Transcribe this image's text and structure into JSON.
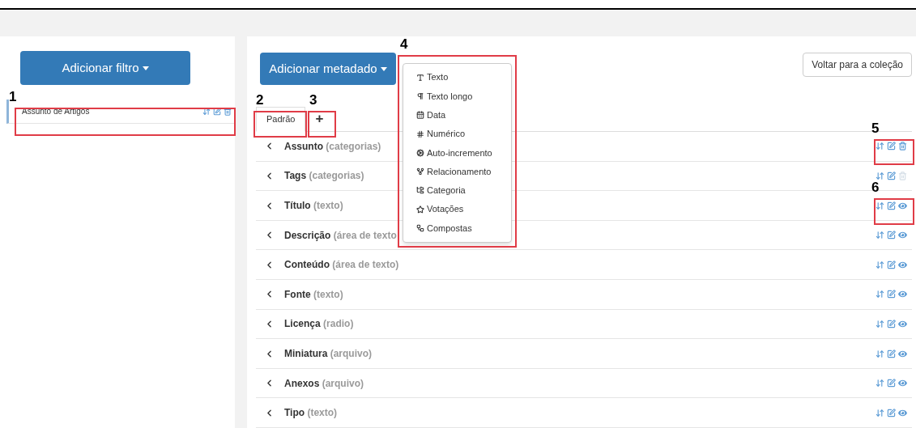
{
  "filter_panel": {
    "add_button": "Adicionar filtro",
    "filters": [
      {
        "label": "Assunto de Artigos"
      }
    ]
  },
  "metadata_panel": {
    "add_button": "Adicionar metadado",
    "back_button": "Voltar para a coleção",
    "tabs": [
      {
        "label": "Padrão",
        "selected": true
      },
      {
        "label": "+",
        "selected": false
      }
    ],
    "rows": [
      {
        "name": "Assunto",
        "type": "(categorias)",
        "kind": "delete",
        "disabled": false
      },
      {
        "name": "Tags",
        "type": "(categorias)",
        "kind": "delete",
        "disabled": true
      },
      {
        "name": "Título",
        "type": "(texto)",
        "kind": "visibility"
      },
      {
        "name": "Descrição",
        "type": "(área de texto",
        "kind": "visibility"
      },
      {
        "name": "Conteúdo",
        "type": "(área de texto)",
        "kind": "visibility"
      },
      {
        "name": "Fonte",
        "type": "(texto)",
        "kind": "visibility"
      },
      {
        "name": "Licença",
        "type": "(radio)",
        "kind": "visibility"
      },
      {
        "name": "Miniatura",
        "type": "(arquivo)",
        "kind": "visibility"
      },
      {
        "name": "Anexos",
        "type": "(arquivo)",
        "kind": "visibility"
      },
      {
        "name": "Tipo",
        "type": "(texto)",
        "kind": "visibility"
      }
    ],
    "dropdown_menu": [
      "Texto",
      "Texto longo",
      "Data",
      "Numérico",
      "Auto-incremento",
      "Relacionamento",
      "Categoria",
      "Votações",
      "Compostas"
    ]
  },
  "annotations": [
    "1",
    "2",
    "3",
    "4",
    "5",
    "6"
  ]
}
